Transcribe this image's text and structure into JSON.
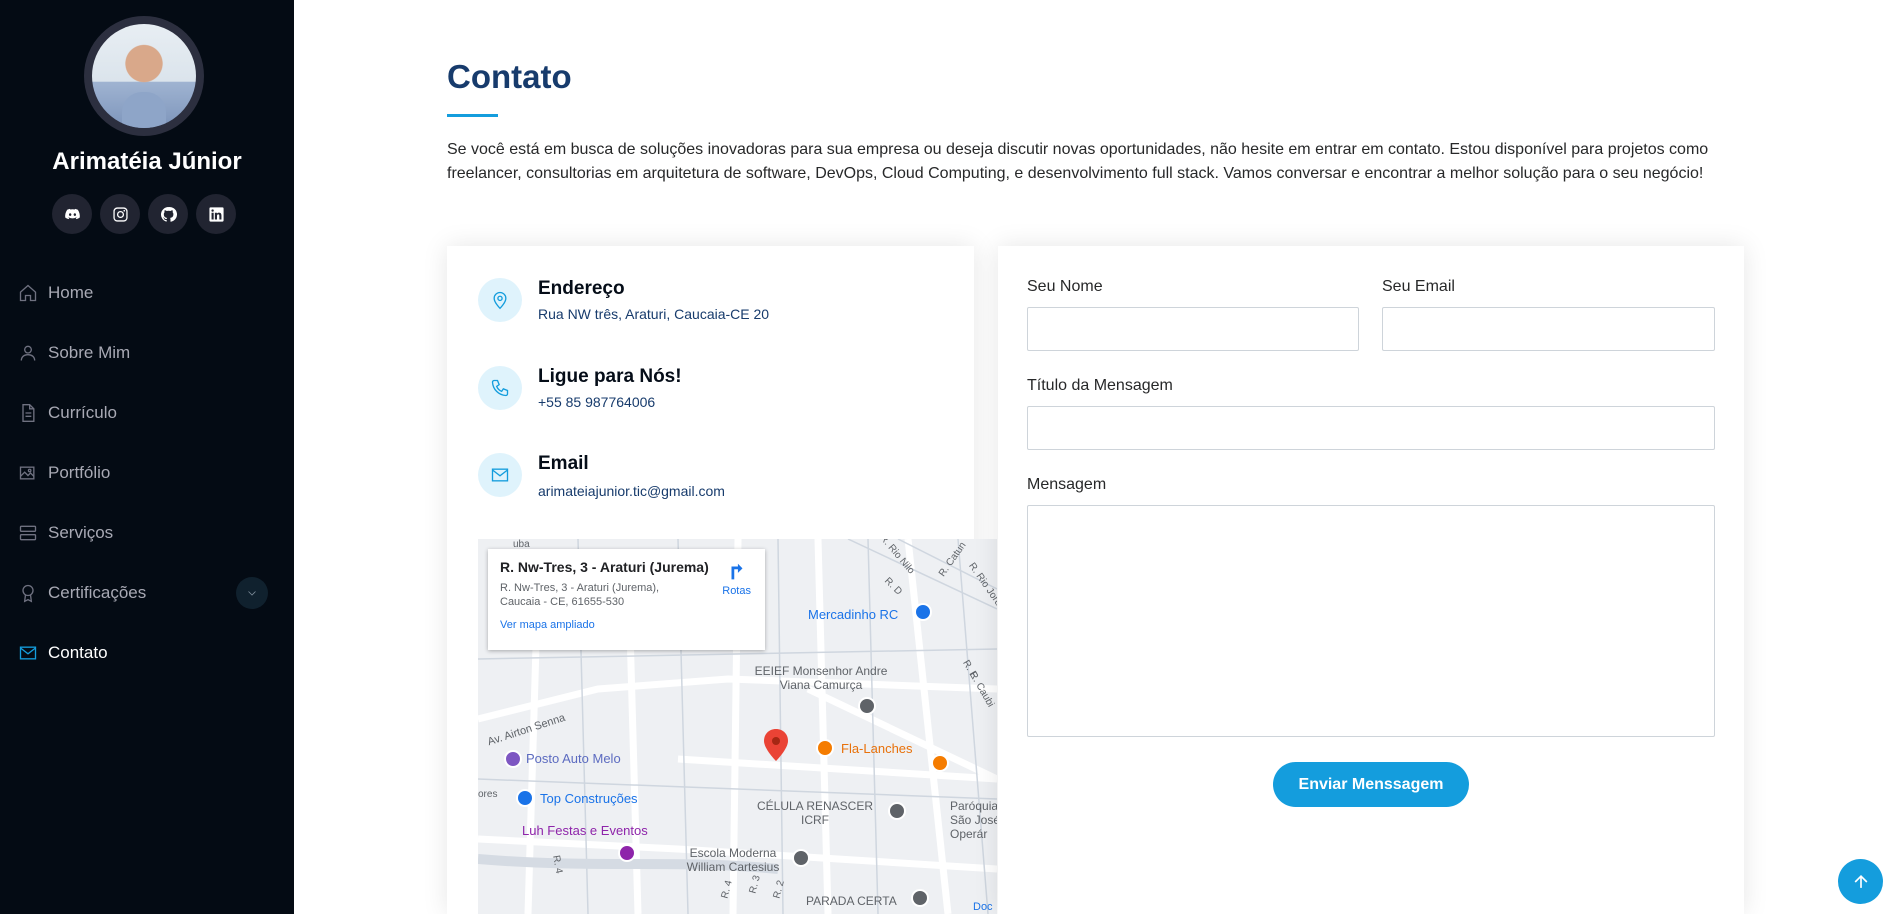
{
  "sidebar": {
    "profile_name": "Arimatéia Júnior",
    "socials": [
      {
        "icon": "discord-icon"
      },
      {
        "icon": "instagram-icon"
      },
      {
        "icon": "github-icon"
      },
      {
        "icon": "linkedin-icon"
      }
    ],
    "nav": [
      {
        "label": "Home",
        "icon": "home-icon"
      },
      {
        "label": "Sobre Mim",
        "icon": "person-icon"
      },
      {
        "label": "Currículo",
        "icon": "file-icon"
      },
      {
        "label": "Portfólio",
        "icon": "images-icon"
      },
      {
        "label": "Serviços",
        "icon": "server-icon"
      },
      {
        "label": "Certificações",
        "icon": "award-icon"
      },
      {
        "label": "Contato",
        "icon": "envelope-icon",
        "active": true
      }
    ]
  },
  "main": {
    "title": "Contato",
    "intro": "Se você está em busca de soluções inovadoras para sua empresa ou deseja discutir novas oportunidades, não hesite em entrar em contato. Estou disponível para projetos como freelancer, consultorias em arquitetura de software, DevOps, Cloud Computing, e desenvolvimento full stack. Vamos conversar e encontrar a melhor solução para o seu negócio!"
  },
  "info": {
    "address_heading": "Endereço",
    "address_text": "Rua NW três, Araturi, Caucaia-CE 20",
    "phone_heading": "Ligue para Nós!",
    "phone_text": "+55 85 987764006",
    "email_heading": "Email",
    "email_text": "arimateiajunior.tic@gmail.com"
  },
  "map": {
    "card_title": "R. Nw-Tres, 3 - Araturi (Jurema)",
    "card_address": "R. Nw-Tres, 3 - Araturi (Jurema), Caucaia - CE, 61655-530",
    "card_link": "Ver mapa ampliado",
    "directions_label": "Rotas",
    "places": {
      "mercadinho": "Mercadinho RC",
      "school1": "EEIEF Monsenhor Andre Viana Camurça",
      "fla": "Fla-Lanches",
      "posto": "Posto Auto Melo",
      "top": "Top Construções",
      "luh": "Luh Festas e Eventos",
      "celula": "CÉLULA RENASCER ICRF",
      "paroquia": "Paróquia São José Operár",
      "escola": "Escola Moderna William Cartesius",
      "parada": "PARADA CERTA",
      "airton": "Av. Airton Senna",
      "rio_nilo": "R. Rio Nilo",
      "catun": "R. Catun",
      "rio_jord": "R. Rio Jord",
      "rd": "R. D",
      "re": "R. E",
      "caubi": "R. Caubi",
      "r4a": "R. 4",
      "r4b": "R. 4",
      "r3": "R. 3",
      "r2": "R. 2",
      "doc": "Doc",
      "uba": "uba",
      "ores": "ores"
    }
  },
  "form": {
    "name_label": "Seu Nome",
    "email_label": "Seu Email",
    "subject_label": "Título da Mensagem",
    "message_label": "Mensagem",
    "submit_label": "Enviar Menssagem"
  },
  "colors": {
    "sidebar_bg": "#040b14",
    "accent": "#149ddd",
    "heading": "#173b6c"
  }
}
